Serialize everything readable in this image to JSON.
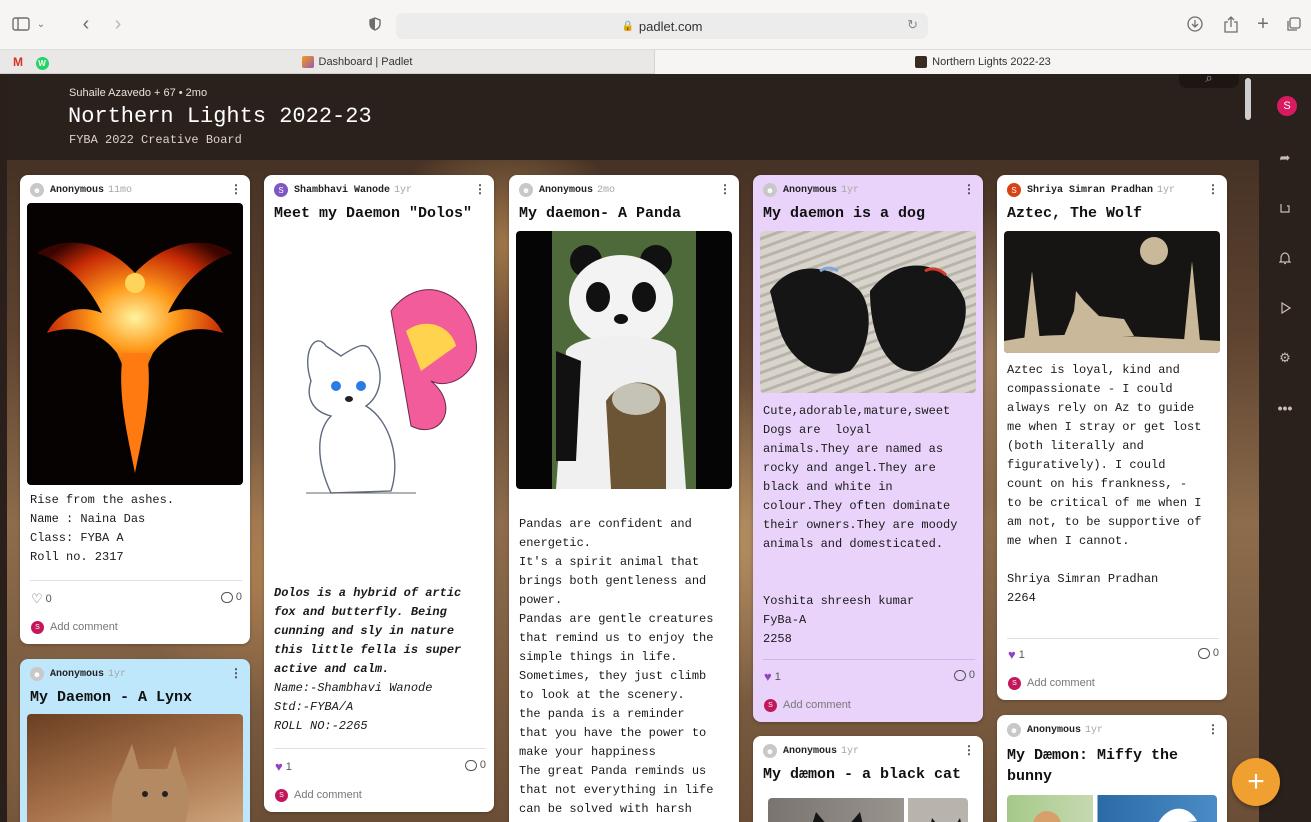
{
  "browser": {
    "url": "padlet.com",
    "tabs": [
      {
        "label": "Dashboard | Padlet"
      },
      {
        "label": "Northern Lights 2022-23"
      }
    ],
    "pinned": [
      "M",
      "W"
    ]
  },
  "board": {
    "meta": "Suhaile Azavedo + 67 • 2mo",
    "title": "Northern Lights 2022-23",
    "subtitle": "FYBA 2022 Creative Board",
    "avatar_letter": "S"
  },
  "cards": [
    {
      "author": "Anonymous",
      "time": "11mo",
      "title": "",
      "body": "Rise from the ashes.\nName : Naina Das\nClass: FYBA A\nRoll no. 2317",
      "likes": "0",
      "comments": "0",
      "add_comment": "Add comment"
    },
    {
      "author": "Anonymous",
      "time": "1yr",
      "title": "My Daemon - A Lynx"
    },
    {
      "author": "Shambhavi Wanode",
      "time": "1yr",
      "title": "Meet my Daemon \"Dolos\"",
      "body": "Dolos is a hybrid of artic\nfox and butterfly. Being\ncunning and sly in nature\nthis little fella is super\nactive and calm.",
      "body2": "Name:-Shambhavi Wanode\nStd:-FYBA/A\nROLL NO:-2265",
      "likes": "1",
      "comments": "0",
      "add_comment": "Add comment"
    },
    {
      "author": "Anonymous",
      "time": "2mo",
      "title": "My daemon- A Panda",
      "body": "Pandas are confident and\nenergetic.\nIt's a spirit animal that\nbrings both gentleness and\npower.\nPandas are gentle creatures\nthat remind us to enjoy the\nsimple things in life.\nSometimes, they just climb\nto look at the scenery.\nthe panda is a reminder\nthat you have the power to\nmake your happiness\nThe great Panda reminds us\nthat not everything in life\ncan be solved with harsh"
    },
    {
      "author": "Anonymous",
      "time": "1yr",
      "title": "My daemon is a dog",
      "body": "Cute,adorable,mature,sweet\nDogs are  loyal\nanimals.They are named as\nrocky and angel.They are\nblack and white in\ncolour.They often dominate\ntheir owners.They are moody\nanimals and domesticated.\n\n\nYoshita shreesh kumar\nFyBa-A\n2258",
      "likes": "1",
      "comments": "0",
      "add_comment": "Add comment"
    },
    {
      "author": "Anonymous",
      "time": "1yr",
      "title": "My dæmon - a black cat"
    },
    {
      "author": "Shriya Simran Pradhan",
      "time": "1yr",
      "title": "Aztec, The Wolf",
      "body": "Aztec is loyal, kind and\ncompassionate - I could\nalways rely on Az to guide\nme when I stray or get lost\n(both literally and\nfiguratively). I could\ncount on his frankness, -\nto be critical of me when I\nam not, to be supportive of\nme when I cannot.\n\nShriya Simran Pradhan\n2264",
      "likes": "1",
      "comments": "0",
      "add_comment": "Add comment"
    },
    {
      "author": "Anonymous",
      "time": "1yr",
      "title": "My Dæmon: Miffy the\nbunny"
    }
  ],
  "icons": {
    "sidebar": "sidebar-icon",
    "back": "chevron-left-icon",
    "forward": "chevron-right-icon",
    "shield": "shield-icon",
    "download": "download-icon",
    "share": "share-icon",
    "new_tab": "plus-icon",
    "tabs": "tabs-icon",
    "search": "search-icon",
    "rail": [
      "share-arrow-icon",
      "remake-icon",
      "bell-icon",
      "play-icon",
      "gear-icon",
      "more-icon"
    ],
    "fab": "plus-icon"
  },
  "colors": {
    "header_bg": "#2b211c",
    "lilac_card": "#ead3fb",
    "blue_card": "#bfe7fb",
    "fab": "#f0a030",
    "like_active": "#8e44c4"
  }
}
